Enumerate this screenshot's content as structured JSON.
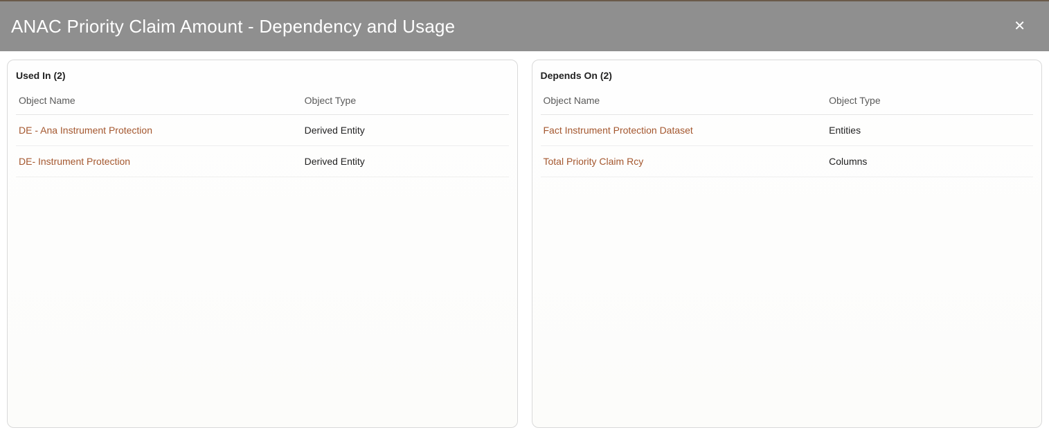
{
  "header": {
    "title": "ANAC Priority Claim Amount - Dependency and Usage",
    "close_glyph": "✕"
  },
  "panels": {
    "used_in": {
      "heading": "Used In (2)",
      "columns": {
        "name": "Object Name",
        "type": "Object Type"
      },
      "rows": [
        {
          "name": "DE - Ana Instrument Protection",
          "type": "Derived Entity"
        },
        {
          "name": "DE- Instrument Protection",
          "type": "Derived Entity"
        }
      ]
    },
    "depends_on": {
      "heading": "Depends On (2)",
      "columns": {
        "name": "Object Name",
        "type": "Object Type"
      },
      "rows": [
        {
          "name": "Fact Instrument Protection Dataset",
          "type": "Entities"
        },
        {
          "name": "Total Priority Claim Rcy",
          "type": "Columns"
        }
      ]
    }
  }
}
